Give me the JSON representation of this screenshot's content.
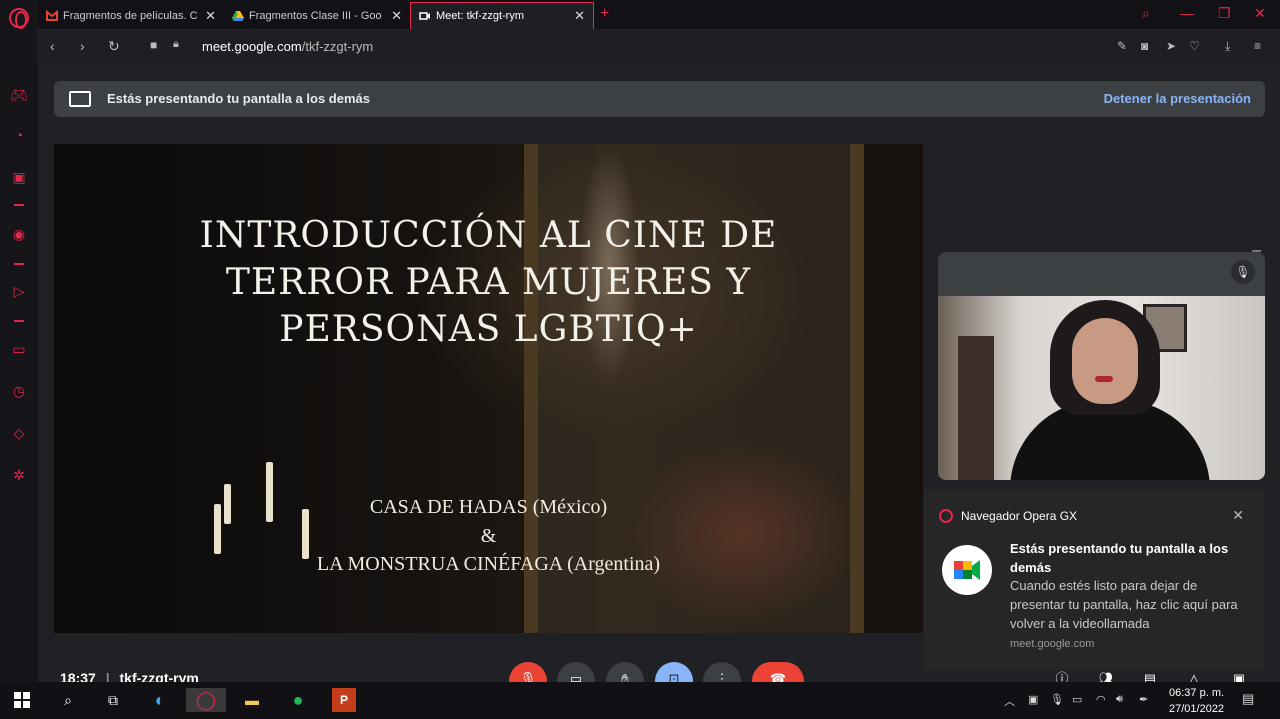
{
  "browser": {
    "tabs": [
      {
        "label": "Fragmentos de películas. C",
        "favicon": "gmail-icon"
      },
      {
        "label": "Fragmentos Clase III - Goo",
        "favicon": "google-drive-icon"
      },
      {
        "label": "Meet: tkf-zzgt-rym",
        "favicon": "meet-icon",
        "active": true
      }
    ],
    "url_domain": "meet.google.com",
    "url_path": "/tkf-zzgt-rym",
    "accent_color": "#e4264a"
  },
  "meet": {
    "banner_text": "Estás presentando tu pantalla a los demás",
    "stop_label": "Detener la presentación",
    "slide": {
      "title_lines": [
        "INTRODUCCIÓN AL CINE DE",
        "TERROR PARA MUJERES Y",
        "PERSONAS LGBTIQ+"
      ],
      "subtitle_lines": [
        "CASA DE HADAS (México)",
        "&",
        "LA MONSTRUA CINÉFAGA (Argentina)"
      ]
    },
    "bottom": {
      "time": "18:37",
      "meeting_code": "tkf-zzgt-rym"
    }
  },
  "notification": {
    "app": "Navegador Opera GX",
    "title": "Estás presentando tu pantalla a los demás",
    "body": "Cuando estés listo para dejar de presentar tu pantalla, haz clic aquí para volver a la videollamada",
    "source": "meet.google.com"
  },
  "taskbar": {
    "clock_time": "06:37 p. m.",
    "clock_date": "27/01/2022"
  }
}
